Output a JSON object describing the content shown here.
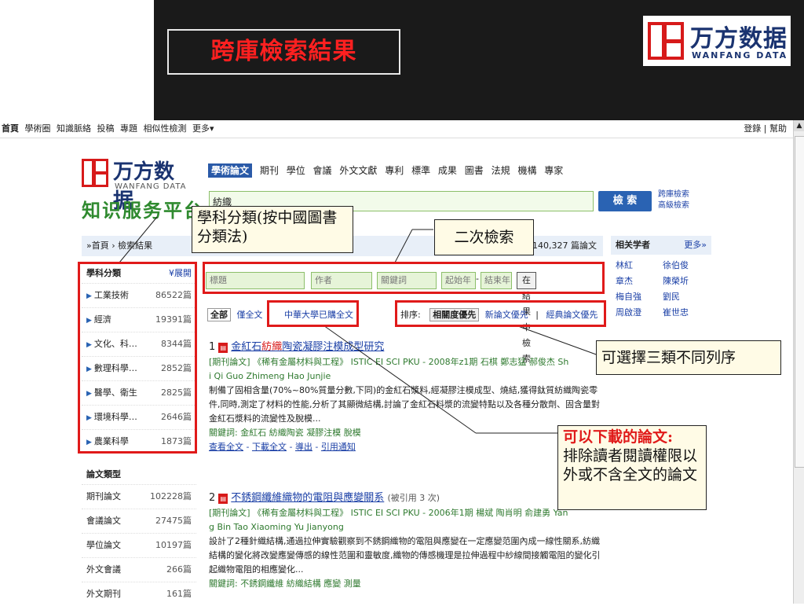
{
  "slide": {
    "title": "跨庫檢索結果"
  },
  "brand": {
    "cn": "万方数据",
    "en": "WANFANG DATA",
    "platform": "知识服务平台",
    "site_en": "WANFANG DATA"
  },
  "sitebar": {
    "items": [
      "首頁",
      "學術圈",
      "知識脈絡",
      "投稿",
      "專題",
      "相似性檢測",
      "更多▾"
    ],
    "login": "登錄",
    "help": "幫助"
  },
  "tabs": [
    "學術論文",
    "期刊",
    "學位",
    "會議",
    "外文文獻",
    "專利",
    "標準",
    "成果",
    "圖書",
    "法規",
    "機構",
    "專家"
  ],
  "search": {
    "value": "紡織",
    "button": "檢 索",
    "cross_search": "跨庫檢索",
    "advanced": "高級檢索"
  },
  "breadcrumb": {
    "home": "»首頁",
    "sep": "›",
    "current": "檢索結果"
  },
  "result_count": "140,327 篇論文",
  "scholars": {
    "title": "相关学者",
    "more": "更多»",
    "names": [
      "林紅",
      "徐伯俊",
      "章杰",
      "陳榮圻",
      "梅自強",
      "劉民",
      "周啟澄",
      "崔世忠"
    ]
  },
  "subjects": {
    "title": "學科分類",
    "expand": "¥展開",
    "items": [
      {
        "label": "工業技術",
        "count": "86522篇"
      },
      {
        "label": "經濟",
        "count": "19391篇"
      },
      {
        "label": "文化、科…",
        "count": "8344篇"
      },
      {
        "label": "數理科學…",
        "count": "2852篇"
      },
      {
        "label": "醫學、衛生",
        "count": "2825篇"
      },
      {
        "label": "環境科學…",
        "count": "2646篇"
      },
      {
        "label": "農業科學",
        "count": "1873篇"
      }
    ]
  },
  "types": {
    "title": "論文類型",
    "items": [
      {
        "label": "期刊論文",
        "count": "102228篇"
      },
      {
        "label": "會議論文",
        "count": "27475篇"
      },
      {
        "label": "學位論文",
        "count": "10197篇"
      },
      {
        "label": "外文會議",
        "count": "266篇"
      },
      {
        "label": "外文期刊",
        "count": "161篇"
      }
    ]
  },
  "filter": {
    "title_ph": "標題",
    "author_ph": "作者",
    "keyword_ph": "關鍵詞",
    "start_year_ph": "起始年",
    "dash": "-",
    "end_year_ph": "結束年",
    "button": "在結果中檢索"
  },
  "scope": {
    "all": "全部",
    "fulltext": "僅全文",
    "purchased": "中華大學已購全文"
  },
  "sort": {
    "label": "排序:",
    "relevance": "相關度優先",
    "newest": "新論文優先",
    "sep": "|",
    "classic": "經典論文優先"
  },
  "results": [
    {
      "num": "1",
      "title_a": "金紅石",
      "title_hl": "紡織",
      "title_b": "陶瓷凝膠注模成型研究",
      "cited": "",
      "meta": "[期刊論文] 《稀有金屬材料與工程》 ISTIC EI SCI PKU - 2008年z1期 石棋 鄭志猛 郝俊杰 Sh",
      "meta2": "i Qi  Guo Zhimeng  Hao Junjie",
      "abstract": "制備了固相含量(70%~80%質量分數,下同)的金紅石漿料,經凝膠注模成型、燒結,獲得鈦質紡織陶瓷零件,同時,測定了材料的性能,分析了其顯微結構,討論了金紅石料漿的流變特點以及各種分散劑、固含量對金紅石漿料的流變性及脫模...",
      "keywords": "關鍵詞: 金紅石  紡織陶瓷  凝膠注模  脫模",
      "links": [
        "查看全文",
        "下載全文",
        "導出",
        "引用通知"
      ]
    },
    {
      "num": "2",
      "title_a": "不銹鋼纖維織物的電阻與應變關系",
      "title_hl": "",
      "title_b": "",
      "cited": "(被引用 3 次)",
      "meta": "[期刊論文] 《稀有金屬材料與工程》 ISTIC EI SCI PKU - 2006年1期 楊斌 陶肖明 俞建勇 Yan",
      "meta2": "g Bin  Tao Xiaoming  Yu Jianyong",
      "abstract": "設計了2種針織結構,通過拉伸實驗觀察到不銹鋼織物的電阻與應變在一定應變范圍內成一線性關系,紡織結構的變化將改變應變傳感的線性范圍和靈敏度,織物的傳感機理是拉伸過程中紗線間接觸電阻的變化引起織物電阻的相應變化...",
      "keywords": "關鍵詞: 不銹鋼纖維  紡織結構  應變  測量",
      "links": []
    }
  ],
  "callouts": {
    "subject": "學科分類(按中國圖書分類法)",
    "secondary": "二次檢索",
    "sort": "可選擇三類不同列序",
    "download_title": "可以下載的論文:",
    "download_body": "排除讀者閱讀權限以外或不含全文的論文"
  },
  "colors": {
    "annotation_red": "#e01a1a",
    "brand_red": "#d71a1a",
    "brand_navy": "#1a3370",
    "link_blue": "#1a3fa6",
    "keyword_green": "#2f7a2f"
  }
}
